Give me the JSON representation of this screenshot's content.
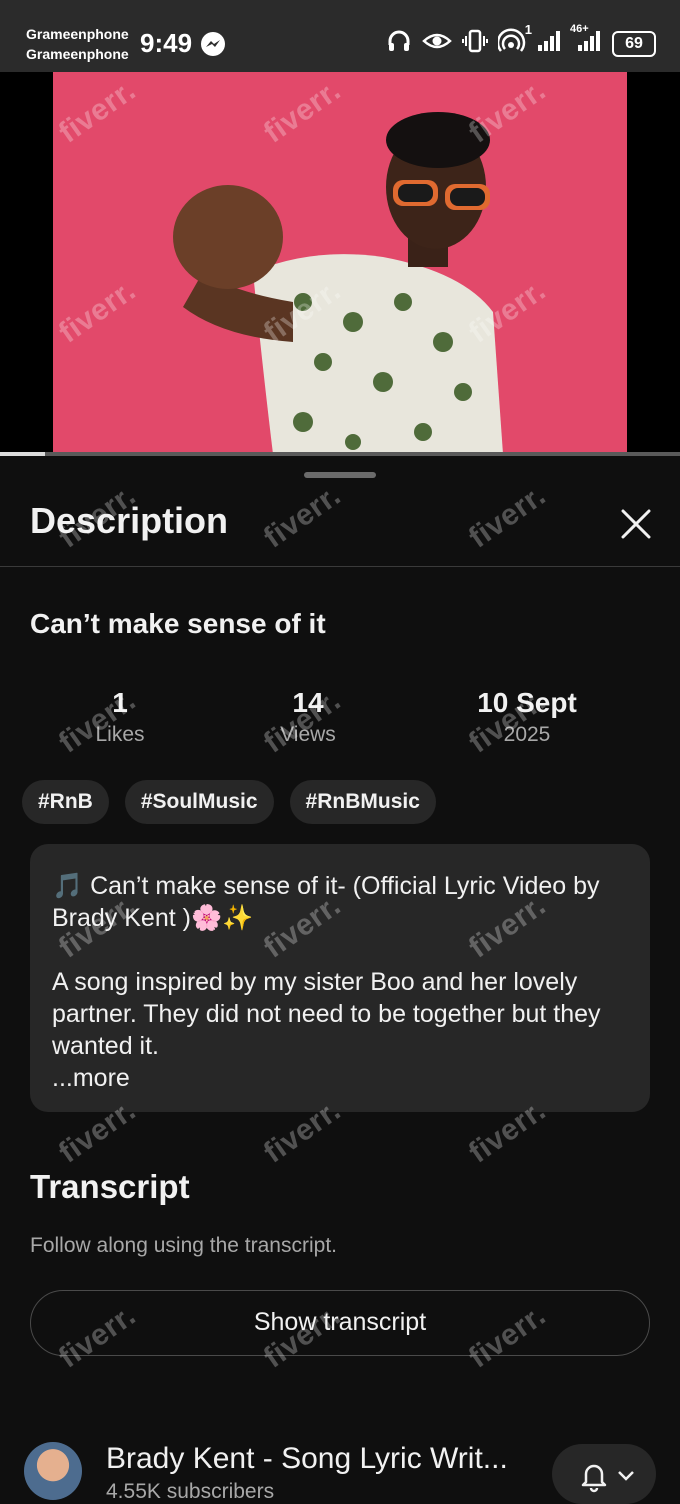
{
  "status_bar": {
    "carrier_1": "Grameenphone",
    "carrier_2": "Grameenphone",
    "time": "9:49",
    "network_badge": "46+",
    "notification_count": "1",
    "battery": "69"
  },
  "video": {
    "progress_fraction": 0.066
  },
  "panel": {
    "title": "Description"
  },
  "details": {
    "video_title": "Can’t make sense of it",
    "stats": [
      {
        "value": "1",
        "label": "Likes"
      },
      {
        "value": "14",
        "label": "Views"
      },
      {
        "value": "10 Sept",
        "label": "2025"
      }
    ],
    "hashtags": [
      "#RnB",
      "#SoulMusic",
      "#RnBMusic"
    ],
    "description_line_1": "🎵 Can’t make sense of it- (Official Lyric Video by Brady Kent )🌸✨",
    "description_line_2": "A song inspired by my sister Boo and her lovely partner. They did not need to be together but they wanted it.",
    "more_label": "...more"
  },
  "transcript": {
    "title": "Transcript",
    "subtitle": "Follow along using the transcript.",
    "button_label": "Show transcript"
  },
  "channel": {
    "name": "Brady Kent - Song Lyric Writ...",
    "subscribers": "4.55K subscribers"
  },
  "watermark": "fiverr.",
  "colors": {
    "background": "#0f0f0f",
    "surface": "#272727",
    "video_backdrop": "#e2496a",
    "secondary_text": "#a8a8a8"
  }
}
